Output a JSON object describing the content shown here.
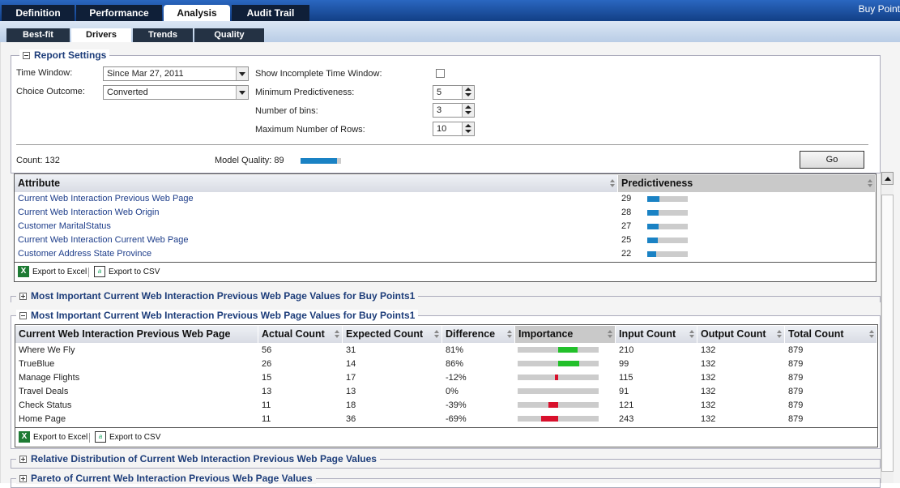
{
  "app": {
    "right_label": "Buy Point"
  },
  "top_tabs": [
    "Definition",
    "Performance",
    "Analysis",
    "Audit Trail"
  ],
  "sub_tabs": [
    "Best-fit",
    "Drivers",
    "Trends",
    "Quality"
  ],
  "settings": {
    "title": "Report Settings",
    "time_window_label": "Time Window:",
    "time_window_value": "Since Mar 27, 2011",
    "choice_outcome_label": "Choice Outcome:",
    "choice_outcome_value": "Converted",
    "show_incomplete_label": "Show Incomplete Time Window:",
    "min_pred_label": "Minimum Predictiveness:",
    "min_pred_value": "5",
    "bins_label": "Number of bins:",
    "bins_value": "3",
    "max_rows_label": "Maximum Number of Rows:",
    "max_rows_value": "10",
    "count_text": "Count: 132",
    "quality_text": "Model Quality: 89",
    "quality_level": 0.89,
    "go_label": "Go"
  },
  "attributes": {
    "headers": [
      "Attribute",
      "Predictiveness"
    ],
    "rows": [
      {
        "name": "Current Web Interaction Previous Web Page",
        "value": "29",
        "level": 0.29
      },
      {
        "name": "Current Web Interaction Web Origin",
        "value": "28",
        "level": 0.28
      },
      {
        "name": "Customer MaritalStatus",
        "value": "27",
        "level": 0.27
      },
      {
        "name": "Current Web Interaction Current Web Page",
        "value": "25",
        "level": 0.25
      },
      {
        "name": "Customer Address State Province",
        "value": "22",
        "level": 0.22
      }
    ]
  },
  "export": {
    "excel": "Export to Excel",
    "csv": "Export to CSV"
  },
  "section_collapsed_1": "Most Important Current Web Interaction Previous Web Page Values for Buy Points1",
  "section_expanded": "Most Important Current Web Interaction Previous Web Page Values for Buy Points1",
  "values_table": {
    "headers": [
      "Current Web Interaction Previous Web Page",
      "Actual Count",
      "Expected Count",
      "Difference",
      "Importance",
      "Input Count",
      "Output Count",
      "Total Count"
    ],
    "rows": [
      {
        "page": "Where We Fly",
        "actual": "56",
        "expected": "31",
        "diff": "81%",
        "importance": 0.81,
        "input": "210",
        "output": "132",
        "total": "879"
      },
      {
        "page": "TrueBlue",
        "actual": "26",
        "expected": "14",
        "diff": "86%",
        "importance": 0.86,
        "input": "99",
        "output": "132",
        "total": "879"
      },
      {
        "page": "Manage Flights",
        "actual": "15",
        "expected": "17",
        "diff": "-12%",
        "importance": -0.12,
        "input": "115",
        "output": "132",
        "total": "879"
      },
      {
        "page": "Travel Deals",
        "actual": "13",
        "expected": "13",
        "diff": "0%",
        "importance": 0,
        "input": "91",
        "output": "132",
        "total": "879"
      },
      {
        "page": "Check Status",
        "actual": "11",
        "expected": "18",
        "diff": "-39%",
        "importance": -0.39,
        "input": "121",
        "output": "132",
        "total": "879"
      },
      {
        "page": "Home Page",
        "actual": "11",
        "expected": "36",
        "diff": "-69%",
        "importance": -0.69,
        "input": "243",
        "output": "132",
        "total": "879"
      }
    ],
    "pos_color": "#22c02a",
    "neg_color": "#d8102c"
  },
  "section_distribution": "Relative Distribution of Current Web Interaction Previous Web Page Values",
  "section_pareto": "Pareto of Current Web Interaction Previous Web Page Values"
}
